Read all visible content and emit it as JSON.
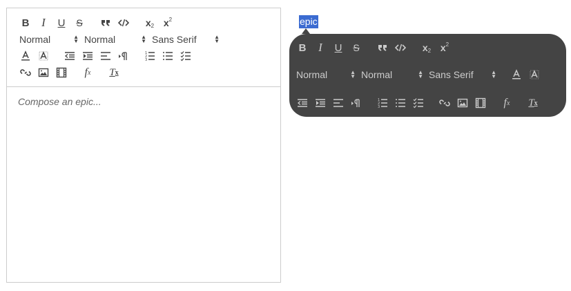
{
  "snow": {
    "pickers": {
      "header": "Normal",
      "size": "Normal",
      "font": "Sans Serif"
    },
    "placeholder": "Compose an epic...",
    "toolbar_icons": [
      "bold-icon",
      "italic-icon",
      "underline-icon",
      "strike-icon",
      "blockquote-icon",
      "code-block-icon",
      "subscript-icon",
      "superscript-icon",
      "text-color-icon",
      "background-color-icon",
      "outdent-icon",
      "indent-icon",
      "align-icon",
      "direction-icon",
      "ordered-list-icon",
      "bullet-list-icon",
      "check-list-icon",
      "link-icon",
      "image-icon",
      "video-icon",
      "formula-icon",
      "clean-icon"
    ]
  },
  "bubble": {
    "selected_text": "epic",
    "pickers": {
      "header": "Normal",
      "size": "Normal",
      "font": "Sans Serif"
    }
  },
  "colors": {
    "toolbar_icon": "#444444",
    "bubble_bg": "#444444",
    "bubble_icon": "#cccccc",
    "selection": "#3b6bd1",
    "border": "#cccccc"
  }
}
